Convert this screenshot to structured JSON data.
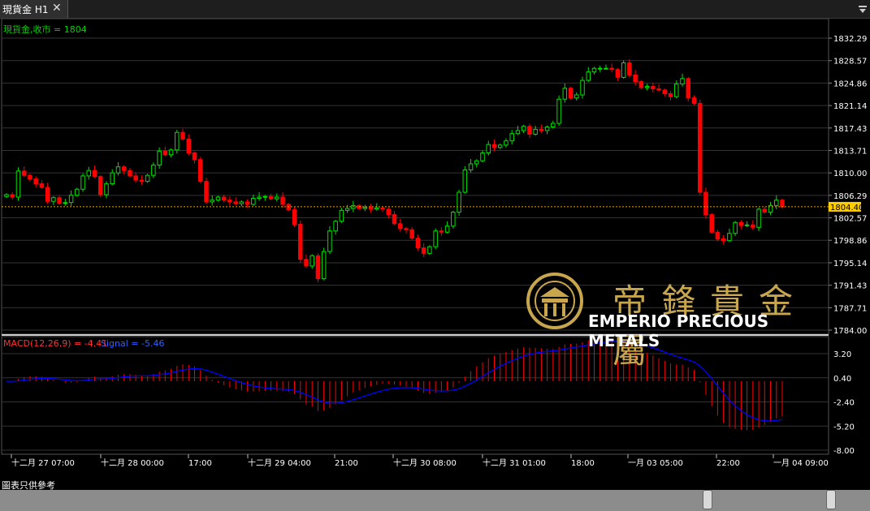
{
  "tab": {
    "title": "現貨金 H1",
    "close_glyph": "✕"
  },
  "main_panel": {
    "indicator_label": "現貨金,收市 = 1804"
  },
  "macd_panel": {
    "macd_label": "MACD(12,26,9) = -4.41",
    "signal_label": "Signal = -5.46"
  },
  "price_marker": "1804.40",
  "logo": {
    "cn": "帝鋒貴金屬",
    "en": "EMPERIO PRECIOUS METALS"
  },
  "footer": {
    "note": "圖表只供參考"
  },
  "colors": {
    "up": "#00e000",
    "down": "#ff0000",
    "signal": "#0000ff",
    "macd": "#ff0000",
    "marker": "#ffcc00",
    "grid": "#333333",
    "text": "#ffffff"
  },
  "chart_data": [
    {
      "type": "candlestick",
      "title": "現貨金 H1",
      "price_ticks": [
        "1832.29",
        "1828.57",
        "1824.86",
        "1821.14",
        "1817.43",
        "1813.71",
        "1810.00",
        "1806.29",
        "1802.57",
        "1798.86",
        "1795.14",
        "1791.43",
        "1787.71",
        "1784.00"
      ],
      "ylim": [
        1784.0,
        1832.29
      ],
      "current_price": 1804.4,
      "time_ticks": [
        "十二月 27 07:00",
        "十二月 28 00:00",
        "17:00",
        "十二月 29 04:00",
        "21:00",
        "十二月 30 08:00",
        "十二月 31 01:00",
        "18:00",
        "一月 03 05:00",
        "22:00",
        "一月 04 09:00"
      ],
      "closes": [
        1806.4,
        1806.0,
        1810.3,
        1809.6,
        1809.0,
        1808.2,
        1807.6,
        1805.3,
        1805.9,
        1805.0,
        1805.1,
        1806.3,
        1807.3,
        1809.5,
        1810.4,
        1809.4,
        1806.4,
        1808.2,
        1810.0,
        1811.0,
        1810.4,
        1809.5,
        1808.8,
        1808.6,
        1809.6,
        1811.3,
        1813.6,
        1813.0,
        1813.8,
        1816.7,
        1815.6,
        1813.3,
        1812.2,
        1808.6,
        1805.2,
        1805.5,
        1806.0,
        1805.5,
        1805.2,
        1804.9,
        1805.2,
        1804.8,
        1805.8,
        1806.0,
        1806.1,
        1805.7,
        1806.0,
        1804.8,
        1803.9,
        1801.5,
        1795.7,
        1794.6,
        1796.3,
        1792.5,
        1797.0,
        1800.4,
        1802.0,
        1803.8,
        1804.1,
        1804.6,
        1804.1,
        1804.3,
        1804.0,
        1804.2,
        1804.0,
        1803.1,
        1801.6,
        1800.8,
        1800.6,
        1799.2,
        1797.6,
        1796.7,
        1797.8,
        1800.4,
        1800.2,
        1801.2,
        1803.5,
        1806.8,
        1810.5,
        1811.5,
        1812.0,
        1813.3,
        1814.7,
        1814.2,
        1814.6,
        1815.3,
        1816.5,
        1817.0,
        1817.7,
        1816.4,
        1817.2,
        1817.0,
        1817.6,
        1818.2,
        1822.2,
        1824.0,
        1822.4,
        1822.9,
        1825.3,
        1826.7,
        1827.3,
        1827.3,
        1827.3,
        1827.1,
        1825.8,
        1828.2,
        1826.2,
        1825.1,
        1824.1,
        1824.3,
        1823.9,
        1823.7,
        1823.1,
        1822.6,
        1824.7,
        1825.6,
        1822.4,
        1821.5,
        1806.8,
        1803.1,
        1800.2,
        1799.1,
        1798.8,
        1800.0,
        1801.8,
        1801.3,
        1801.4,
        1801.0,
        1804.0,
        1803.5,
        1804.6,
        1805.5,
        1804.4
      ],
      "macd_ticks": [
        "3.20",
        "0.40",
        "-2.40",
        "-5.20",
        "-8.00"
      ],
      "macd_ylim": [
        -8.0,
        3.2
      ]
    }
  ]
}
